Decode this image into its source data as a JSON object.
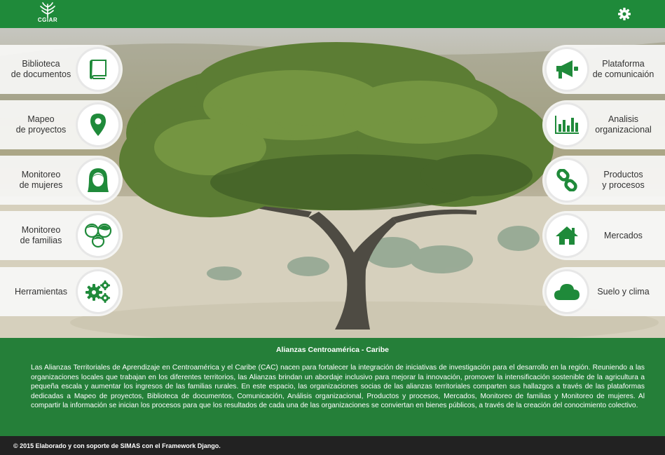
{
  "header": {
    "logo_text": "CGIAR",
    "accent_color": "#1f8a3a",
    "settings_icon": "gear-icon"
  },
  "left_buttons": [
    {
      "label": "Biblioteca de documentos",
      "line1": "Biblioteca",
      "line2": "de documentos",
      "icon": "book-icon"
    },
    {
      "label": "Mapeo de proyectos",
      "line1": "Mapeo",
      "line2": "de proyectos",
      "icon": "map-pin-icon"
    },
    {
      "label": "Monitoreo de mujeres",
      "line1": "Monitoreo",
      "line2": "de mujeres",
      "icon": "woman-icon"
    },
    {
      "label": "Monitoreo de familias",
      "line1": "Monitoreo",
      "line2": "de familias",
      "icon": "family-icon"
    },
    {
      "label": "Herramientas",
      "line1": "Herramientas",
      "line2": "",
      "icon": "gears-icon"
    }
  ],
  "right_buttons": [
    {
      "label": "Plataforma de comunicaión",
      "line1": "Plataforma",
      "line2": "de comunicaión",
      "icon": "megaphone-icon"
    },
    {
      "label": "Analisis organizacional",
      "line1": "Analisis",
      "line2": "organizacional",
      "icon": "bar-chart-icon"
    },
    {
      "label": "Productos y procesos",
      "line1": "Productos",
      "line2": "y procesos",
      "icon": "chain-link-icon"
    },
    {
      "label": "Mercados",
      "line1": "Mercados",
      "line2": "",
      "icon": "house-icon"
    },
    {
      "label": "Suelo y clima",
      "line1": "Suelo y clima",
      "line2": "",
      "icon": "cloud-icon"
    }
  ],
  "info": {
    "title": "Alianzas Centroamérica - Caribe",
    "body": "Las Alianzas Territoriales de Aprendizaje en Centroamérica y el Caribe (CAC) nacen para fortalecer la integración de iniciativas de investigación para el desarrollo en la región. Reuniendo a las organizaciones locales que trabajan en los diferentes territorios, las Alianzas brindan un abordaje inclusivo para mejorar la innovación, promover la intensificación sostenible de la agricultura a pequeña escala y aumentar los ingresos de las familias rurales. En este espacio, las organizaciones socias de las alianzas territoriales comparten sus hallazgos a través de las plataformas dedicadas a Mapeo de proyectos, Biblioteca de documentos, Comunicación, Análisis organizacional, Productos y procesos, Mercados, Monitoreo de familias y Monitoreo de mujeres. Al compartir la información se inician los procesos para que los resultados de cada una de las organizaciones se conviertan en bienes públicos, a través de la creación del conocimiento colectivo."
  },
  "footer": {
    "text": "© 2015 Elaborado y con soporte de SIMAS con el Framework Django."
  }
}
